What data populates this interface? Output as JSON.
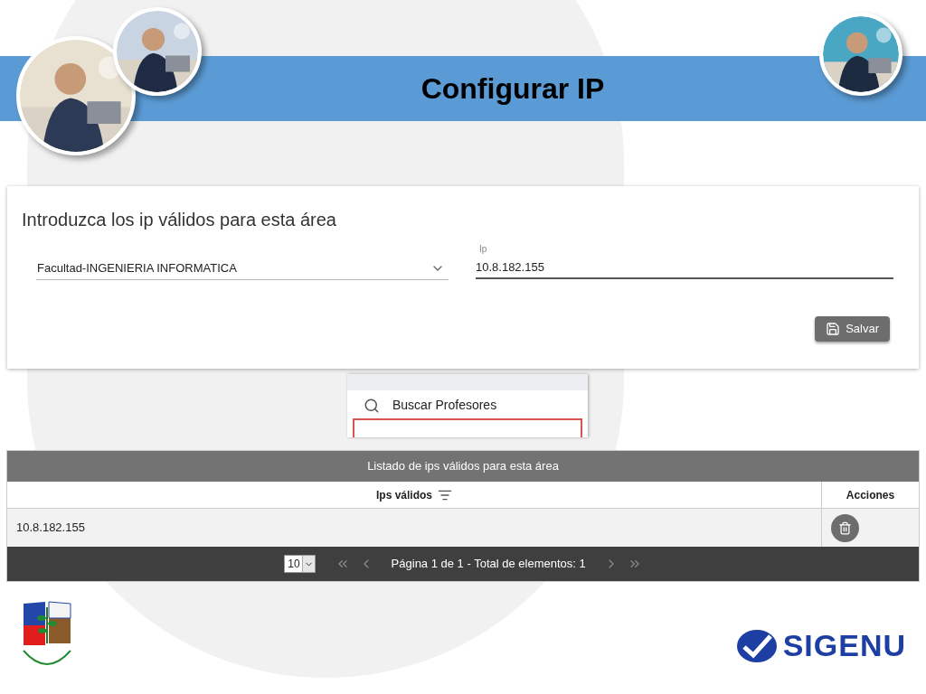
{
  "slide": {
    "title": "Configurar IP"
  },
  "form": {
    "heading": "Introduzca los ip válidos para esta área",
    "area_select": {
      "value": "Facultad-INGENIERIA INFORMATICA"
    },
    "ip_field": {
      "label": "Ip",
      "value": "10.8.182.155"
    },
    "save_button": "Salvar"
  },
  "snippet": {
    "search_label": "Buscar Profesores"
  },
  "table": {
    "title": "Listado de ips válidos para esta área",
    "columns": [
      "Ips válidos",
      "Acciones"
    ],
    "rows": [
      {
        "ip": "10.8.182.155"
      }
    ]
  },
  "pagination": {
    "page_size": "10",
    "summary": "Página 1 de 1 - Total de elementos: 1"
  },
  "logo": {
    "text": "SIGENU"
  }
}
